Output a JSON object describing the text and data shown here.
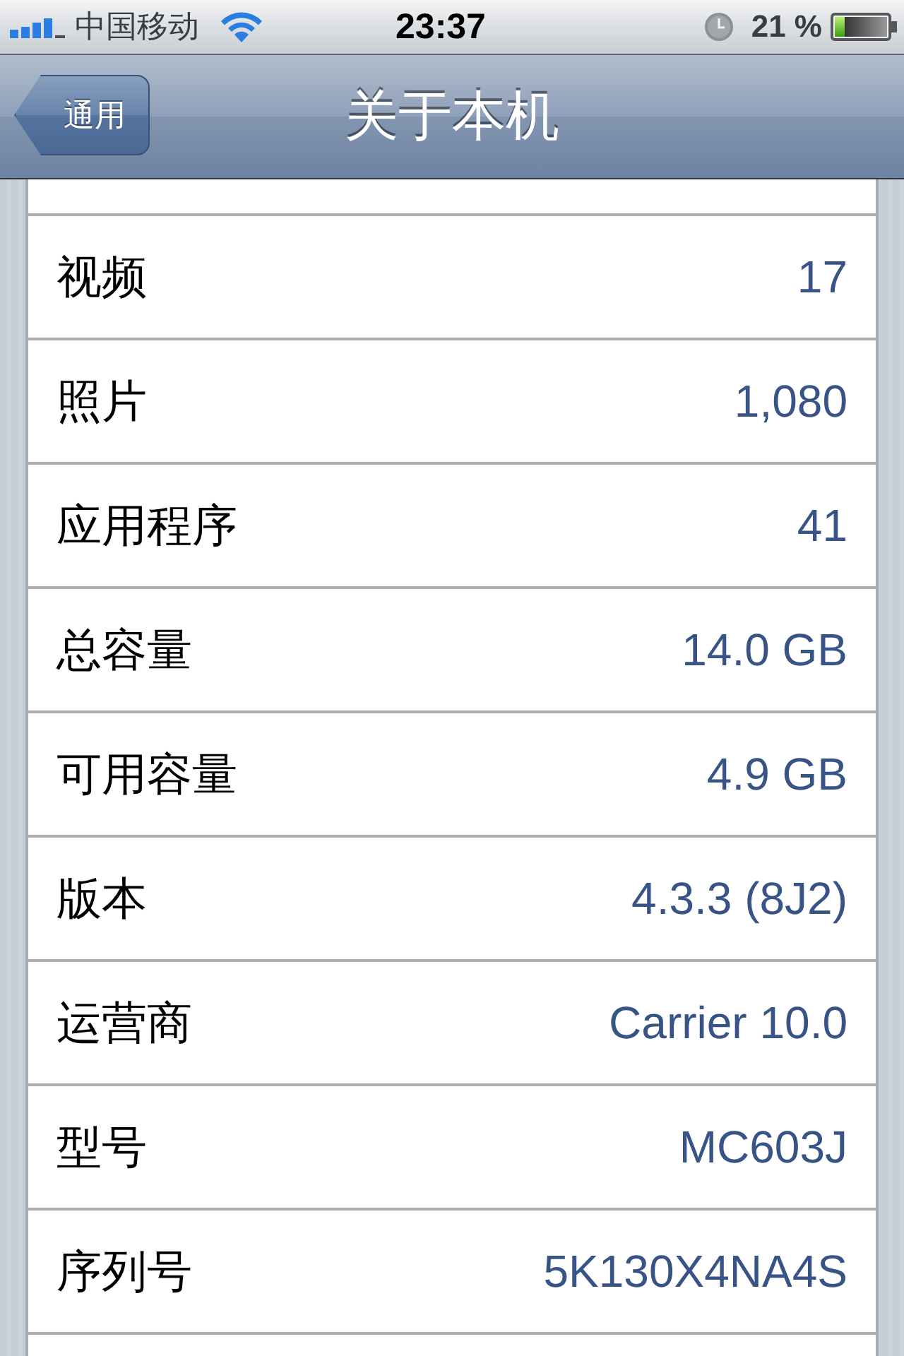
{
  "status_bar": {
    "carrier": "中国移动",
    "time": "23:37",
    "battery": "21 %"
  },
  "nav_bar": {
    "back_button": "通用",
    "title": "关于本机"
  },
  "rows": [
    {
      "label": "视频",
      "value": "17"
    },
    {
      "label": "照片",
      "value": "1,080"
    },
    {
      "label": "应用程序",
      "value": "41"
    },
    {
      "label": "总容量",
      "value": "14.0 GB"
    },
    {
      "label": "可用容量",
      "value": "4.9 GB"
    },
    {
      "label": "版本",
      "value": "4.3.3 (8J2)"
    },
    {
      "label": "运营商",
      "value": "Carrier 10.0"
    },
    {
      "label": "型号",
      "value": "MC603J"
    },
    {
      "label": "序列号",
      "value": "5K130X4NA4S"
    }
  ]
}
